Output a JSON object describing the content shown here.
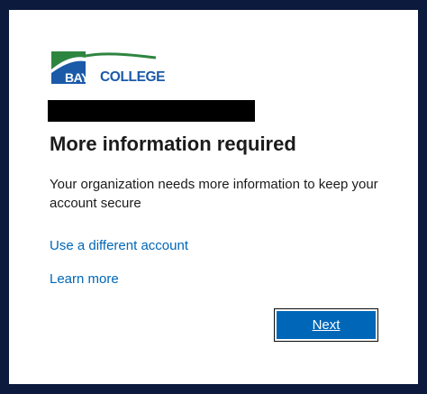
{
  "logo": {
    "bay": "BAY",
    "college": "COLLEGE",
    "colors": {
      "green": "#2e8540",
      "blue": "#1a5aa8"
    }
  },
  "page": {
    "title": "More information required",
    "description": "Your organization needs more information to keep your account secure"
  },
  "links": {
    "different_account": "Use a different account",
    "learn_more": "Learn more"
  },
  "buttons": {
    "next": "Next"
  },
  "colors": {
    "accent": "#0067b8",
    "background": "#0b1a3d"
  }
}
